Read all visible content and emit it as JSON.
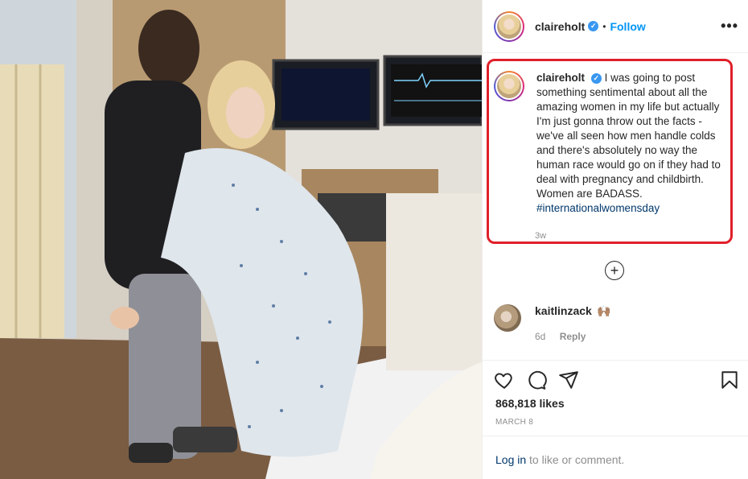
{
  "post": {
    "author": "claireholt",
    "follow_label": "Follow",
    "dot": "•",
    "more_label": "•••",
    "verified_mark": "✓",
    "caption_username": "claireholt",
    "caption_text": "I was going to post something sentimental about all the amazing women in my life but actually I'm just gonna throw out the facts - we've all seen how men handle colds and there's absolutely no way the human race would go on if they had to deal with pregnancy and childbirth. Women are BADASS.",
    "hashtag": "#internationalwomensday",
    "time_ago": "3w",
    "load_more": "+"
  },
  "comment": {
    "username": "kaitlinzack",
    "emoji": "🙌🏽",
    "time_ago": "6d",
    "reply_label": "Reply"
  },
  "actions": {
    "icons": [
      "heart-icon",
      "comment-icon",
      "share-icon",
      "bookmark-icon"
    ],
    "likes": "868,818 likes",
    "date": "MARCH 8"
  },
  "footer": {
    "login_link": "Log in",
    "login_suffix": " to like or comment."
  },
  "colors": {
    "accent_blue": "#0095f6",
    "hashtag": "#00376b",
    "highlight_red": "#e0202a",
    "muted": "#8e8e8e"
  }
}
